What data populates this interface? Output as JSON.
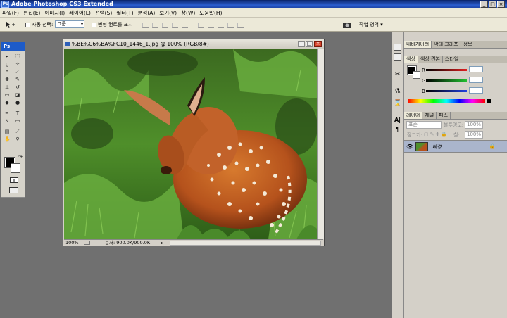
{
  "app": {
    "title": "Adobe Photoshop CS3 Extended",
    "logo": "Ps",
    "window_buttons": [
      "_",
      "□",
      "×"
    ]
  },
  "menu": [
    "파일(F)",
    "편집(E)",
    "이미지(I)",
    "레이어(L)",
    "선택(S)",
    "필터(T)",
    "분석(A)",
    "보기(V)",
    "창(W)",
    "도움말(H)"
  ],
  "options": {
    "auto_select_label": "자동 선택:",
    "auto_select_value": "그룹",
    "transform_label": "변형 컨트롤 표시",
    "workspace_label": "작업 영역 ▾"
  },
  "toolbox": {
    "header": "Ps"
  },
  "document": {
    "title": "%BE%C6%BA%FC10_1446_1.jpg @ 100% (RGB/8#)",
    "zoom": "100%",
    "doc_size": "문서: 900.0K/900.0K",
    "colors": {
      "grass": "#3f7f24",
      "dark": "#1f3a12",
      "fur": "#b5521c"
    }
  },
  "panels": {
    "nav_tabs": [
      "내비게이터",
      "막대 그래프",
      "정보"
    ],
    "color_tabs": [
      "색상",
      "색상 견본",
      "스타일"
    ],
    "channels": [
      {
        "name": "R",
        "value": "",
        "color": "#e02020"
      },
      {
        "name": "G",
        "value": "",
        "color": "#20a030"
      },
      {
        "name": "B",
        "value": "",
        "color": "#2040d0"
      }
    ],
    "layers_tabs": [
      "레이어",
      "채널",
      "패스"
    ],
    "blend_mode": "표준",
    "opacity_label": "불투명도:",
    "opacity_value": "100%",
    "lock_label": "잠그기:",
    "fill_label": "칠:",
    "fill_value": "100%",
    "layer_name": "배경"
  }
}
